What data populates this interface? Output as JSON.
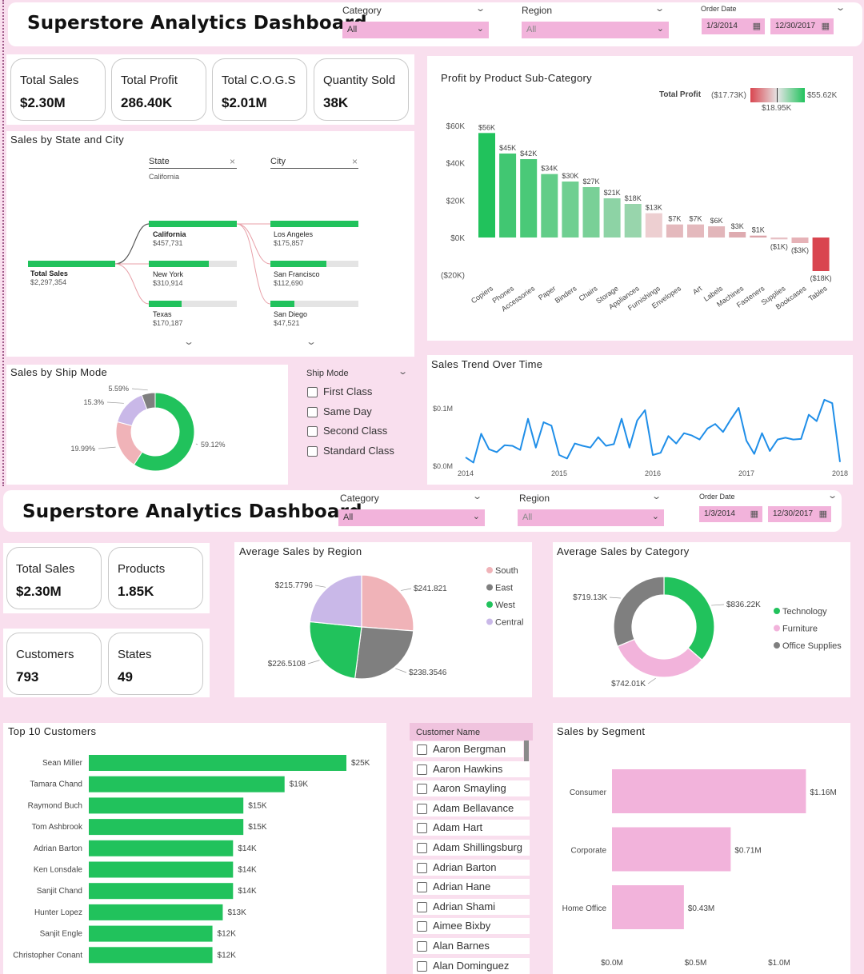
{
  "dashboard1": {
    "title": "Superstore Analytics Dashboard",
    "filters": {
      "category_label": "Category",
      "category_value": "All",
      "region_label": "Region",
      "region_value": "All",
      "date_label": "Order Date",
      "date_start": "1/3/2014",
      "date_end": "12/30/2017"
    },
    "kpis": [
      {
        "label": "Total Sales",
        "value": "$2.30M"
      },
      {
        "label": "Total Profit",
        "value": "286.40K"
      },
      {
        "label": "Total C.O.G.S",
        "value": "$2.01M"
      },
      {
        "label": "Quantity Sold",
        "value": "38K"
      }
    ],
    "tree": {
      "title": "Sales by State and City",
      "state_header": "State",
      "state_sub": "California",
      "city_header": "City",
      "root": {
        "label": "Total Sales",
        "value": "$2,297,354"
      },
      "states": [
        {
          "label": "California",
          "value": "$457,731",
          "fill": 1.0
        },
        {
          "label": "New York",
          "value": "$310,914",
          "fill": 0.68
        },
        {
          "label": "Texas",
          "value": "$170,187",
          "fill": 0.37
        }
      ],
      "cities": [
        {
          "label": "Los Angeles",
          "value": "$175,857",
          "fill": 1.0
        },
        {
          "label": "San Francisco",
          "value": "$112,690",
          "fill": 0.64
        },
        {
          "label": "San Diego",
          "value": "$47,521",
          "fill": 0.27
        }
      ]
    },
    "ship": {
      "title": "Sales by Ship Mode",
      "slicer_title": "Ship Mode",
      "options": [
        "First Class",
        "Same Day",
        "Second Class",
        "Standard Class"
      ]
    },
    "profit_chart": {
      "title": "Profit by Product Sub-Category",
      "legend_label": "Total Profit",
      "legend_min": "($17.73K)",
      "legend_max": "$55.62K",
      "legend_mid": "$18.95K"
    },
    "trend": {
      "title": "Sales Trend Over Time"
    }
  },
  "dashboard2": {
    "title": "Superstore Analytics Dashboard",
    "filters": {
      "category_label": "Category",
      "category_value": "All",
      "region_label": "Region",
      "region_value": "All",
      "date_label": "Order Date",
      "date_start": "1/3/2014",
      "date_end": "12/30/2017"
    },
    "kpis": [
      {
        "label": "Total Sales",
        "value": "$2.30M"
      },
      {
        "label": "Products",
        "value": "1.85K"
      },
      {
        "label": "Customers",
        "value": "793"
      },
      {
        "label": "States",
        "value": "49"
      }
    ],
    "region_title": "Average Sales by Region",
    "category_title": "Average Sales by Category",
    "top_title": "Top 10 Customers",
    "segment_title": "Sales by Segment",
    "customer_slicer": {
      "title": "Customer Name",
      "names": [
        "Aaron Bergman",
        "Aaron Hawkins",
        "Aaron Smayling",
        "Adam Bellavance",
        "Adam Hart",
        "Adam Shillingsburg",
        "Adrian Barton",
        "Adrian Hane",
        "Adrian Shami",
        "Aimee Bixby",
        "Alan Barnes",
        "Alan Dominguez"
      ]
    }
  },
  "colors": {
    "green": "#21c25c",
    "pink": "#f2b3db",
    "gray": "#7f7f7f",
    "lavender": "#c9b8e8",
    "salmon": "#f0b3b8",
    "red": "#d9454f",
    "trend": "#1f8ee8"
  },
  "chart_data": [
    {
      "type": "bar",
      "title": "Profit by Product Sub-Category",
      "categories": [
        "Copiers",
        "Phones",
        "Accessories",
        "Paper",
        "Binders",
        "Chairs",
        "Storage",
        "Appliances",
        "Furnishings",
        "Envelopes",
        "Art",
        "Labels",
        "Machines",
        "Fasteners",
        "Supplies",
        "Bookcases",
        "Tables"
      ],
      "values": [
        56,
        45,
        42,
        34,
        30,
        27,
        21,
        18,
        13,
        7,
        7,
        6,
        3,
        1,
        -1,
        -3,
        -18
      ],
      "data_labels": [
        "$56K",
        "$45K",
        "$42K",
        "$34K",
        "$30K",
        "$27K",
        "$21K",
        "$18K",
        "$13K",
        "$7K",
        "$7K",
        "$6K",
        "$3K",
        "$1K",
        "($1K)",
        "($3K)",
        "($18K)"
      ],
      "y_ticks": [
        "$60K",
        "$40K",
        "$20K",
        "$0K",
        "($20K)"
      ],
      "ylim": [
        -20,
        60
      ]
    },
    {
      "type": "line",
      "title": "Sales Trend Over Time",
      "x_ticks": [
        "2014",
        "2015",
        "2016",
        "2017",
        "2018"
      ],
      "y_ticks": [
        "$0.1M",
        "$0.0M"
      ],
      "ylim": [
        0,
        0.1
      ],
      "x": [
        "2014-01",
        "2014-02",
        "2014-03",
        "2014-04",
        "2014-05",
        "2014-06",
        "2014-07",
        "2014-08",
        "2014-09",
        "2014-10",
        "2014-11",
        "2014-12",
        "2015-01",
        "2015-02",
        "2015-03",
        "2015-04",
        "2015-05",
        "2015-06",
        "2015-07",
        "2015-08",
        "2015-09",
        "2015-10",
        "2015-11",
        "2015-12",
        "2016-01",
        "2016-02",
        "2016-03",
        "2016-04",
        "2016-05",
        "2016-06",
        "2016-07",
        "2016-08",
        "2016-09",
        "2016-10",
        "2016-11",
        "2016-12",
        "2017-01",
        "2017-02",
        "2017-03",
        "2017-04",
        "2017-05",
        "2017-06",
        "2017-07",
        "2017-08",
        "2017-09",
        "2017-10",
        "2017-11",
        "2017-12"
      ],
      "values": [
        0.014,
        0.005,
        0.055,
        0.028,
        0.023,
        0.035,
        0.034,
        0.027,
        0.081,
        0.031,
        0.075,
        0.069,
        0.018,
        0.012,
        0.038,
        0.034,
        0.031,
        0.049,
        0.034,
        0.037,
        0.081,
        0.031,
        0.078,
        0.096,
        0.018,
        0.022,
        0.051,
        0.038,
        0.056,
        0.052,
        0.045,
        0.064,
        0.072,
        0.058,
        0.08,
        0.1,
        0.043,
        0.02,
        0.056,
        0.025,
        0.045,
        0.048,
        0.045,
        0.046,
        0.088,
        0.077,
        0.114,
        0.108,
        0.006
      ]
    },
    {
      "type": "pie",
      "title": "Sales by Ship Mode",
      "categories": [
        "Standard Class",
        "Second Class",
        "First Class",
        "Same Day"
      ],
      "values": [
        59.12,
        19.99,
        15.3,
        5.59
      ],
      "labels": [
        "59.12%",
        "19.99%",
        "15.3%",
        "5.59%"
      ]
    },
    {
      "type": "pie",
      "title": "Average Sales by Region",
      "categories": [
        "South",
        "East",
        "West",
        "Central"
      ],
      "values": [
        241.821,
        238.3546,
        226.5108,
        215.7796
      ],
      "labels": [
        "$241.821",
        "$238.3546",
        "$226.5108",
        "$215.7796"
      ]
    },
    {
      "type": "pie",
      "title": "Average Sales by Category",
      "categories": [
        "Technology",
        "Furniture",
        "Office Supplies"
      ],
      "values": [
        836.22,
        742.01,
        719.13
      ],
      "labels": [
        "$836.22K",
        "$742.01K",
        "$719.13K"
      ]
    },
    {
      "type": "bar",
      "title": "Top 10 Customers",
      "categories": [
        "Sean Miller",
        "Tamara Chand",
        "Raymond Buch",
        "Tom Ashbrook",
        "Adrian Barton",
        "Ken Lonsdale",
        "Sanjit Chand",
        "Hunter Lopez",
        "Sanjit Engle",
        "Christopher Conant"
      ],
      "values": [
        25,
        19,
        15,
        15,
        14,
        14,
        14,
        13,
        12,
        12
      ],
      "data_labels": [
        "$25K",
        "$19K",
        "$15K",
        "$15K",
        "$14K",
        "$14K",
        "$14K",
        "$13K",
        "$12K",
        "$12K"
      ]
    },
    {
      "type": "bar",
      "title": "Sales by Segment",
      "categories": [
        "Consumer",
        "Corporate",
        "Home Office"
      ],
      "values": [
        1.16,
        0.71,
        0.43
      ],
      "data_labels": [
        "$1.16M",
        "$0.71M",
        "$0.43M"
      ],
      "x_ticks": [
        "$0.0M",
        "$0.5M",
        "$1.0M"
      ],
      "xlim": [
        0,
        1.2
      ]
    }
  ]
}
